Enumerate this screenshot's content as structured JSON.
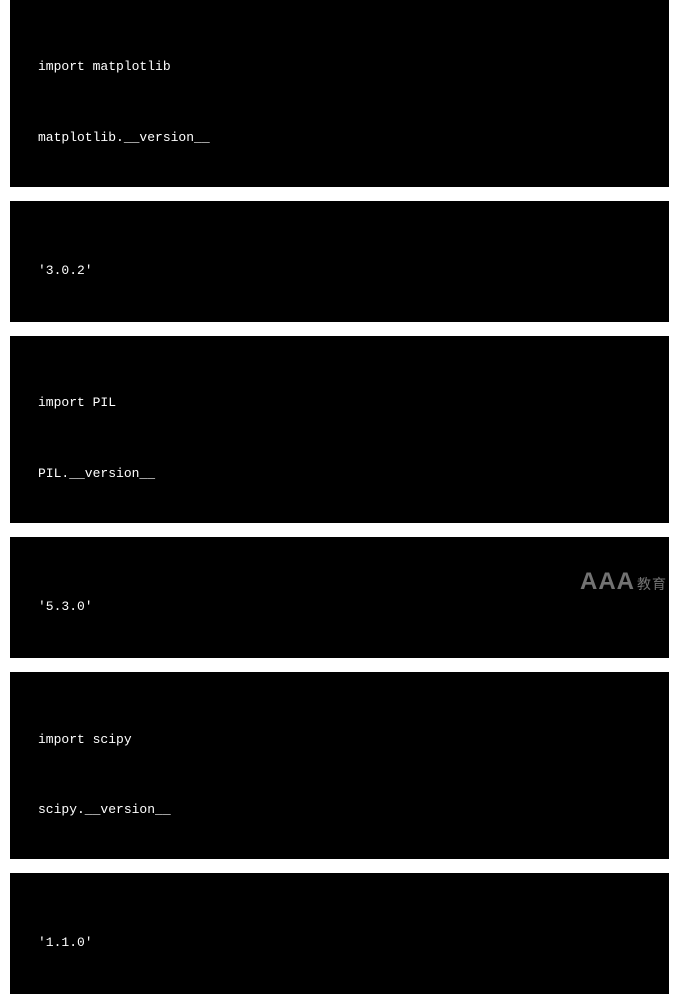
{
  "cells": [
    {
      "type": "code",
      "lines": [
        "import matplotlib",
        "matplotlib.__version__"
      ]
    },
    {
      "type": "output",
      "text": "'3.0.2'"
    },
    {
      "type": "code",
      "lines": [
        "import PIL",
        "PIL.__version__"
      ]
    },
    {
      "type": "output",
      "text": "'5.3.0'"
    },
    {
      "type": "code",
      "lines": [
        "import scipy",
        "scipy.__version__"
      ]
    },
    {
      "type": "output",
      "text": "'1.1.0'"
    }
  ],
  "watermark": {
    "main": "AAA",
    "suffix": "教育"
  }
}
